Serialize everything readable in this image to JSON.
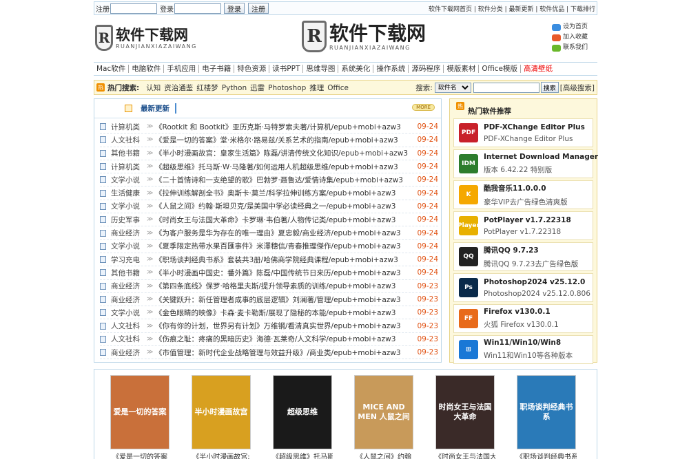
{
  "topbar": {
    "register_label": "注册",
    "login_label": "登录",
    "login_button": "登录",
    "register_button": "注册",
    "links": "软件下载网首页 | 软件分类 | 最新更新 | 软件优品 | 下载排行"
  },
  "header": {
    "logo_left_cn": "软件下载网",
    "logo_left_en": "RUANJIANXIAZAIWANG",
    "logo_center_cn": "软件下载网",
    "logo_center_en": "RUANJIANXIAZAIWANG",
    "logo_letter": "R",
    "set_home": "设为首页",
    "add_favorite": "加入收藏",
    "contact": "联系我们"
  },
  "nav": [
    "Mac软件",
    "电脑软件",
    "手机应用",
    "电子书籍",
    "特色资源",
    "读书PPT",
    "思维导图",
    "系统美化",
    "操作系统",
    "源码程序",
    "模版素材",
    "Office模版",
    "高清壁纸"
  ],
  "search": {
    "title": "热门搜索:",
    "keywords": [
      "认知",
      "资治通鉴",
      "红楼梦",
      "Python",
      "迅雷",
      "Photoshop",
      "推理",
      "Office"
    ],
    "label": "搜索:",
    "select_value": "软件名",
    "button": "搜索",
    "advanced": "[高级搜索]"
  },
  "latest": {
    "title": "最新更新",
    "more": "MORE",
    "items": [
      {
        "cat": "计算机类",
        "title": "《Rootkit 和 Bootkit》亚历克斯·马特罗索夫著/计算机/epub+mobi+azw3",
        "date": "09-24"
      },
      {
        "cat": "人文社科",
        "title": "《爱是一切的答案》堂·米格尔·路易兹/关系艺术的指南/epub+mobi+azw3",
        "date": "09-24"
      },
      {
        "cat": "其他书籍",
        "title": "《半小时漫画故宫：皇家生活篇》陈磊/讲清传统文化知识/epub+mobi+azw3",
        "date": "09-24"
      },
      {
        "cat": "计算机类",
        "title": "《超级思维》托马斯·W·马隆著/如何运用人机超级思维/epub+mobi+azw3",
        "date": "09-24"
      },
      {
        "cat": "文学小说",
        "title": "《二十首情诗和一支绝望的歌》巴勃罗·聂鲁达/爱情诗集/epub+mobi+azw3",
        "date": "09-24"
      },
      {
        "cat": "生活健康",
        "title": "《拉伸训练解剖全书》奥斯卡·莫兰/科学拉伸训练方案/epub+mobi+azw3",
        "date": "09-24"
      },
      {
        "cat": "文学小说",
        "title": "《人鼠之间》约翰·斯坦贝克/是美国中学必读经典之一/epub+mobi+azw3",
        "date": "09-24"
      },
      {
        "cat": "历史军事",
        "title": "《时尚女王与法国大革命》卡罗琳·韦伯著/人物传记类/epub+mobi+azw3",
        "date": "09-24"
      },
      {
        "cat": "商业经济",
        "title": "《为客户服务是华为存在的唯一理由》夏忠毅/商业经济/epub+mobi+azw3",
        "date": "09-24"
      },
      {
        "cat": "文学小说",
        "title": "《夏季限定热带水果百匯事件》米澤穗信/青春推理傑作/epub+mobi+azw3",
        "date": "09-24"
      },
      {
        "cat": "学习充电",
        "title": "《职场谈判经典书系》套装共3册/哈佛商学院经典课程/epub+mobi+azw3",
        "date": "09-24"
      },
      {
        "cat": "其他书籍",
        "title": "《半小时漫画中国史：番外篇》陈磊/中国传统节日来历/epub+mobi+azw3",
        "date": "09-24"
      },
      {
        "cat": "商业经济",
        "title": "《第四条底线》保罗·哈格里夫斯/提升领导素质的训练/epub+mobi+azw3",
        "date": "09-23"
      },
      {
        "cat": "商业经济",
        "title": "《关键跃升：新任管理者成事的底层逻辑》刘澜著/管理/epub+mobi+azw3",
        "date": "09-23"
      },
      {
        "cat": "文学小说",
        "title": "《金色眼睛的映像》卡森·麦卡勒斯/展现了隐秘的本能/epub+mobi+azw3",
        "date": "09-23"
      },
      {
        "cat": "人文社科",
        "title": "《你有你的计划，世界另有计划》万维钢/看清真实世界/epub+mobi+azw3",
        "date": "09-23"
      },
      {
        "cat": "人文社科",
        "title": "《伤痕之耻：疼痛的黑暗历史》海德·瓦莱奇/人文科学/epub+mobi+azw3",
        "date": "09-23"
      },
      {
        "cat": "商业经济",
        "title": "《市值管理：新时代企业战略管理与效益升级》/商业类/epub+mobi+azw3",
        "date": "09-23"
      }
    ]
  },
  "hot": {
    "title": "热门软件推荐",
    "items": [
      {
        "name": "PDF-XChange Editor Plus",
        "sub": "PDF-XChange Editor Plus",
        "icon": "pdf-xchange-icon",
        "icon_text": "PDF",
        "color": "#c8202a"
      },
      {
        "name": "Internet Download Manager",
        "sub": "版本 6.42.22 特别版",
        "icon": "idm-icon",
        "icon_text": "IDM",
        "color": "#2d7d2d"
      },
      {
        "name": "酷我音乐11.0.0.0",
        "sub": "豪华VIP去广告绿色清爽版",
        "icon": "kuwo-icon",
        "icon_text": "K",
        "color": "#f5a800"
      },
      {
        "name": "PotPlayer v1.7.22318",
        "sub": "PotPlayer v1.7.22318",
        "icon": "potplayer-icon",
        "icon_text": "Player",
        "color": "#e8b000"
      },
      {
        "name": "腾讯QQ 9.7.23",
        "sub": "腾讯QQ 9.7.23去广告绿色版",
        "icon": "qq-icon",
        "icon_text": "QQ",
        "color": "#222222"
      },
      {
        "name": "Photoshop2024 v25.12.0",
        "sub": "Photoshop2024 v25.12.0.806",
        "icon": "photoshop-icon",
        "icon_text": "Ps",
        "color": "#0a2a4a"
      },
      {
        "name": "Firefox v130.0.1",
        "sub": "火狐 Firefox v130.0.1",
        "icon": "firefox-icon",
        "icon_text": "FF",
        "color": "#e86a1a"
      },
      {
        "name": "Win11/Win10/Win8",
        "sub": "Win11和Win10等各种版本",
        "icon": "windows-icon",
        "icon_text": "⊞",
        "color": "#1a78d6"
      }
    ]
  },
  "books": [
    {
      "title": "《爱是一切的答案",
      "cover": "爱是一切的答案",
      "color": "#c9703a"
    },
    {
      "title": "《半小时漫画故宫:",
      "cover": "半小时漫画故宫",
      "color": "#d8a020"
    },
    {
      "title": "《超级思维》托马斯",
      "cover": "超级思维",
      "color": "#1a1a1a"
    },
    {
      "title": "《人鼠之间》约翰",
      "cover": "MICE AND MEN 人鼠之间",
      "color": "#c89a5a"
    },
    {
      "title": "《时尚女王与法国大",
      "cover": "时尚女王与法国大革命",
      "color": "#3a2a28"
    },
    {
      "title": "《职场谈判经典书系",
      "cover": "职场谈判经典书系",
      "color": "#2a7ab8"
    }
  ]
}
